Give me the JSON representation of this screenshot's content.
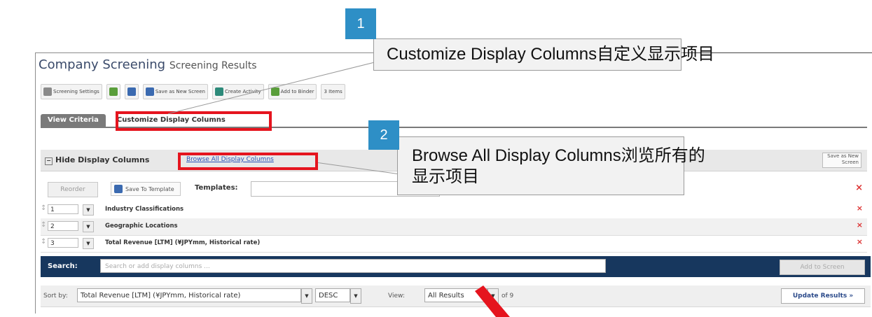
{
  "header": {
    "title": "Company Screening",
    "subtitle": "Screening Results"
  },
  "toolbar": {
    "items": [
      {
        "label": "Screening Settings",
        "icon": "screening-settings-icon"
      },
      {
        "label": "",
        "icon": "excel-icon"
      },
      {
        "label": "",
        "icon": "word-icon"
      },
      {
        "label": "Save as New Screen",
        "icon": "save-icon"
      },
      {
        "label": "Create Activity",
        "icon": "create-activity-icon"
      },
      {
        "label": "Add to Binder",
        "icon": "binder-icon"
      },
      {
        "label": "3 Items",
        "icon": "items-icon"
      }
    ]
  },
  "tabs": {
    "view_criteria": "View Criteria",
    "customize": "Customize Display Columns"
  },
  "display_columns": {
    "hide_label": "Hide Display Columns",
    "browse_link": "Browse All Display Columns",
    "save_as_screen": "Save as New Screen",
    "reorder": "Reorder",
    "save_template": "Save To Template",
    "templates_label": "Templates:",
    "rows": [
      {
        "num": "1",
        "name": "Industry Classifications"
      },
      {
        "num": "2",
        "name": "Geographic Locations"
      },
      {
        "num": "3",
        "name": "Total Revenue [LTM] (¥JPYmm, Historical rate)"
      }
    ]
  },
  "search": {
    "label": "Search:",
    "placeholder": "Search or add display columns ...",
    "add_button": "Add to Screen"
  },
  "sort": {
    "label": "Sort by:",
    "field": "Total Revenue [LTM] (¥JPYmm, Historical rate)",
    "order": "DESC",
    "view_label": "View:",
    "view_value": "All Results",
    "count": "of 9",
    "update_button": "Update Results »"
  },
  "callouts": [
    {
      "number": "1",
      "text": "Customize Display Columns自定义显示项目"
    },
    {
      "number": "2",
      "line1": "Browse All Display Columns浏览所有的",
      "line2": "显示项目"
    }
  ],
  "colors": {
    "callout_blue": "#2e8fc6",
    "highlight_red": "#e5141e",
    "search_bar": "#17375e"
  }
}
